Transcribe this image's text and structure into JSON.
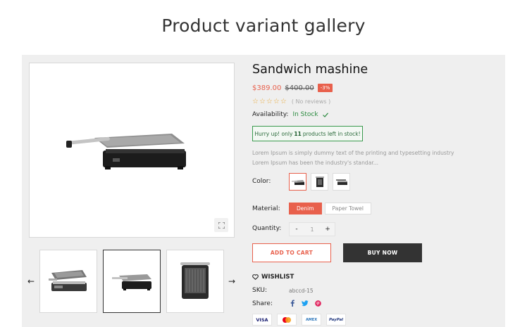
{
  "page": {
    "title": "Product variant gallery"
  },
  "product": {
    "name": "Sandwich mashine",
    "price_sale": "$389.00",
    "price_old": "$400.00",
    "discount": "-3%",
    "stars": "☆☆☆☆☆",
    "reviews": "( No reviews )",
    "availability_label": "Availability:",
    "availability_value": "In Stock",
    "stock_pre": "Hurry up! only",
    "stock_count": "11",
    "stock_post": "products left in stock!",
    "description": "Lorem Ipsum is simply dummy text of the printing and typesetting industry Lorem Ipsum has been the industry's standar...",
    "color_label": "Color:",
    "material_label": "Material:",
    "materials": [
      "Denim",
      "Paper Towel"
    ],
    "quantity_label": "Quantity:",
    "quantity": {
      "minus": "-",
      "value": "1",
      "plus": "+"
    },
    "add_to_cart": "ADD TO CART",
    "buy_now": "BUY NOW",
    "wishlist": "WISHLIST",
    "sku_label": "SKU:",
    "sku_value": "abccd-15",
    "share_label": "Share:",
    "payments": [
      "VISA",
      "mastercard",
      "AMEX",
      "PayPal"
    ]
  },
  "gallery": {
    "prev": "←",
    "next": "→",
    "zoom_icon": "expand-icon"
  },
  "colors": {
    "accent": "#e8604c",
    "stock_green": "#2a8a3e",
    "star": "#e8a93b",
    "dark": "#333333",
    "panel": "#efefef"
  }
}
